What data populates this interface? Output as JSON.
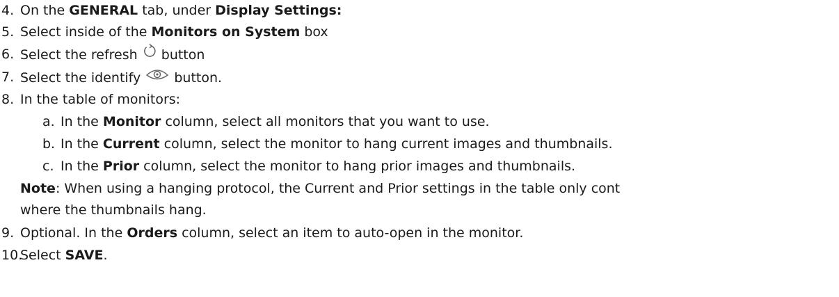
{
  "steps": [
    {
      "num": "4.",
      "t1": "On the ",
      "b1": "GENERAL",
      "t2": " tab, under ",
      "b2": "Display Settings:"
    },
    {
      "num": "5.",
      "t1": "Select inside of the ",
      "b1": "Monitors on System",
      "t2": " box"
    },
    {
      "num": "6.",
      "t1": "Select the refresh ",
      "icon": "refresh-icon",
      "t2": " button"
    },
    {
      "num": "7.",
      "t1": "Select the identify ",
      "icon": "eye-icon",
      "t2": " button."
    },
    {
      "num": "8.",
      "t1": "In the table of monitors:"
    }
  ],
  "substeps": [
    {
      "letter": "a.",
      "t1": "In the ",
      "b1": "Monitor",
      "t2": " column, select all monitors that you want to use."
    },
    {
      "letter": "b.",
      "t1": "In the ",
      "b1": "Current",
      "t2": " column, select the monitor to hang current images and thumbnails."
    },
    {
      "letter": "c.",
      "t1": "In the ",
      "b1": "Prior",
      "t2": " column, select the monitor to hang prior images and thumbnails."
    }
  ],
  "note": {
    "label": "Note",
    "line1": ": When using a hanging protocol, the Current and Prior settings in the table only cont",
    "line2": "where the thumbnails hang."
  },
  "steps_after": [
    {
      "num": "9.",
      "t1": "Optional. In the ",
      "b1": "Orders",
      "t2": " column, select an item to auto-open in the monitor."
    },
    {
      "num": "10.",
      "t1": "Select ",
      "b1": "SAVE",
      "t2": "."
    }
  ],
  "colors": {
    "text": "#1a1a1a",
    "icon": "#666666"
  }
}
